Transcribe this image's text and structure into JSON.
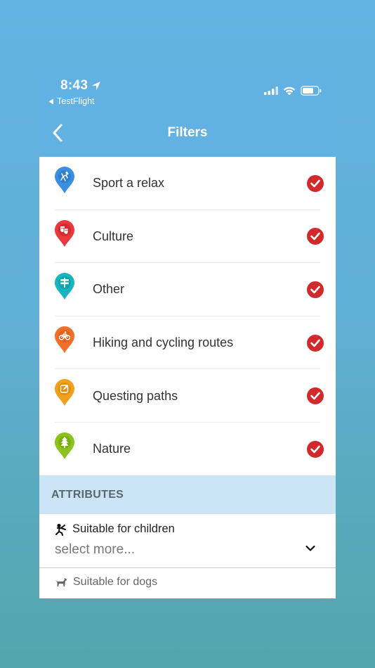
{
  "status_bar": {
    "time": "8:43",
    "back_app": "TestFlight"
  },
  "nav": {
    "title": "Filters"
  },
  "categories": [
    {
      "label": "Sport a relax",
      "color": "#3b8ee0",
      "icon": "sport-icon",
      "checked": true
    },
    {
      "label": "Culture",
      "color": "#e8393e",
      "icon": "theatre-masks-icon",
      "checked": true
    },
    {
      "label": "Other",
      "color": "#18b5c1",
      "icon": "signpost-icon",
      "checked": true
    },
    {
      "label": "Hiking and cycling routes",
      "color": "#f0702a",
      "icon": "bicycle-icon",
      "checked": true
    },
    {
      "label": "Questing paths",
      "color": "#f0a01c",
      "icon": "quest-edit-icon",
      "checked": true
    },
    {
      "label": "Nature",
      "color": "#8cc31f",
      "icon": "tree-icon",
      "checked": true
    }
  ],
  "attributes": {
    "header": "ATTRIBUTES",
    "children_label": "Suitable for children",
    "select_placeholder": "select more...",
    "dogs_label": "Suitable for dogs"
  },
  "colors": {
    "nav_bg": "#62b1e3",
    "check": "#d22a2c",
    "attributes_bg": "#cbe5f6"
  }
}
